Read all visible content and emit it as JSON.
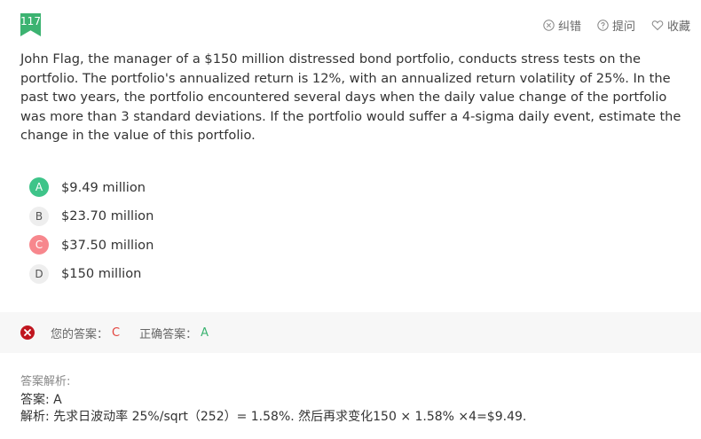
{
  "question_number": "117",
  "actions": {
    "report_label": "纠错",
    "ask_label": "提问",
    "favorite_label": "收藏"
  },
  "question_text": "John Flag, the manager of a $150 million distressed bond portfolio, conducts stress tests on the portfolio. The portfolio's annualized return is 12%, with an annualized return volatility of 25%. In the past two years, the portfolio encountered several days when the daily value change of the portfolio was more than 3 standard deviations. If the portfolio would suffer a 4-sigma daily event, estimate the change in the value of this portfolio.",
  "options": [
    {
      "letter": "A",
      "text": "$9.49 million",
      "state": "correct"
    },
    {
      "letter": "B",
      "text": "$23.70 million",
      "state": "normal"
    },
    {
      "letter": "C",
      "text": "$37.50 million",
      "state": "wrong"
    },
    {
      "letter": "D",
      "text": "$150 million",
      "state": "normal"
    }
  ],
  "result": {
    "your_answer_label": "您的答案：",
    "your_answer": "C",
    "correct_answer_label": "正确答案：",
    "correct_answer": "A"
  },
  "analysis": {
    "title": "答案解析:",
    "answer_line": "答案: A",
    "explanation_line": "解析: 先求日波动率 25%/sqrt（252）= 1.58%. 然后再求变化150 × 1.58% ×4=$9.49."
  },
  "colors": {
    "badge": "#3cb371",
    "correct": "#3ec489",
    "wrong": "#f7878d",
    "wrong_text": "#e2423c",
    "result_icon": "#c0161f"
  }
}
